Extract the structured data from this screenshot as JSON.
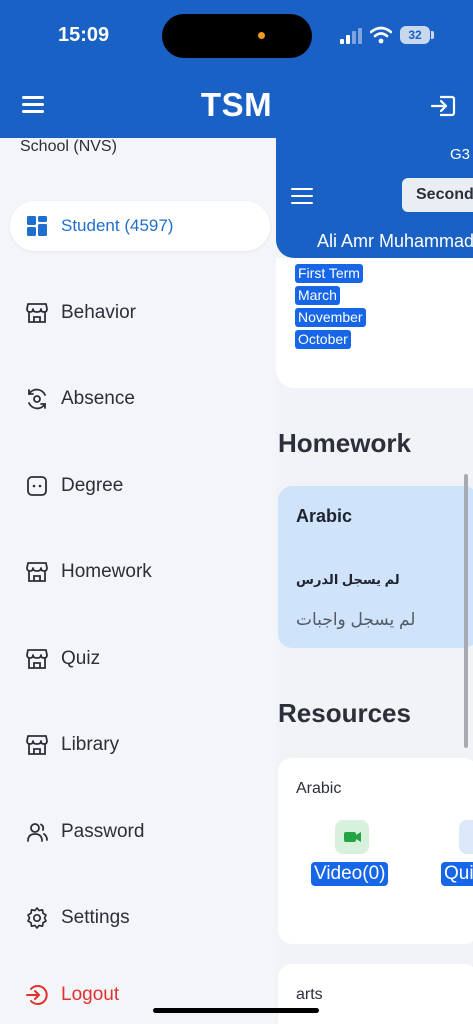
{
  "status_bar": {
    "time": "15:09",
    "battery": "32"
  },
  "app_bar": {
    "title": "TSM"
  },
  "drawer": {
    "school": "School (NVS)",
    "items": [
      {
        "label": "Student (4597)",
        "icon": "grid-icon"
      },
      {
        "label": "Behavior",
        "icon": "store-icon"
      },
      {
        "label": "Absence",
        "icon": "refresh-eye-icon"
      },
      {
        "label": "Degree",
        "icon": "chat-face-icon"
      },
      {
        "label": "Homework",
        "icon": "store-icon"
      },
      {
        "label": "Quiz",
        "icon": "store-icon"
      },
      {
        "label": "Library",
        "icon": "store-icon"
      },
      {
        "label": "Password",
        "icon": "users-icon"
      },
      {
        "label": "Settings",
        "icon": "gear-icon"
      },
      {
        "label": "Logout",
        "icon": "logout-icon"
      }
    ]
  },
  "background_page": {
    "grade": "G3",
    "select_value": "Second",
    "student_name": "Ali Amr Muhammad",
    "terms": [
      "First Term",
      "March",
      "November",
      "October"
    ],
    "homework_heading": "Homework",
    "homework_card": {
      "subject": "Arabic",
      "line1": "لم يسجل الدرس",
      "line2": "لم يسجل واجبات"
    },
    "resources_heading": "Resources",
    "resources": [
      {
        "subject": "Arabic",
        "video_label": "Video(0)",
        "quiz_label": "Quiz"
      },
      {
        "subject": "arts"
      }
    ]
  },
  "colors": {
    "primary": "#1961c4",
    "active_text": "#1e6fce",
    "logout_red": "#e0312e",
    "homework_card": "#cfe3fa",
    "tag_blue": "#1766e8"
  }
}
